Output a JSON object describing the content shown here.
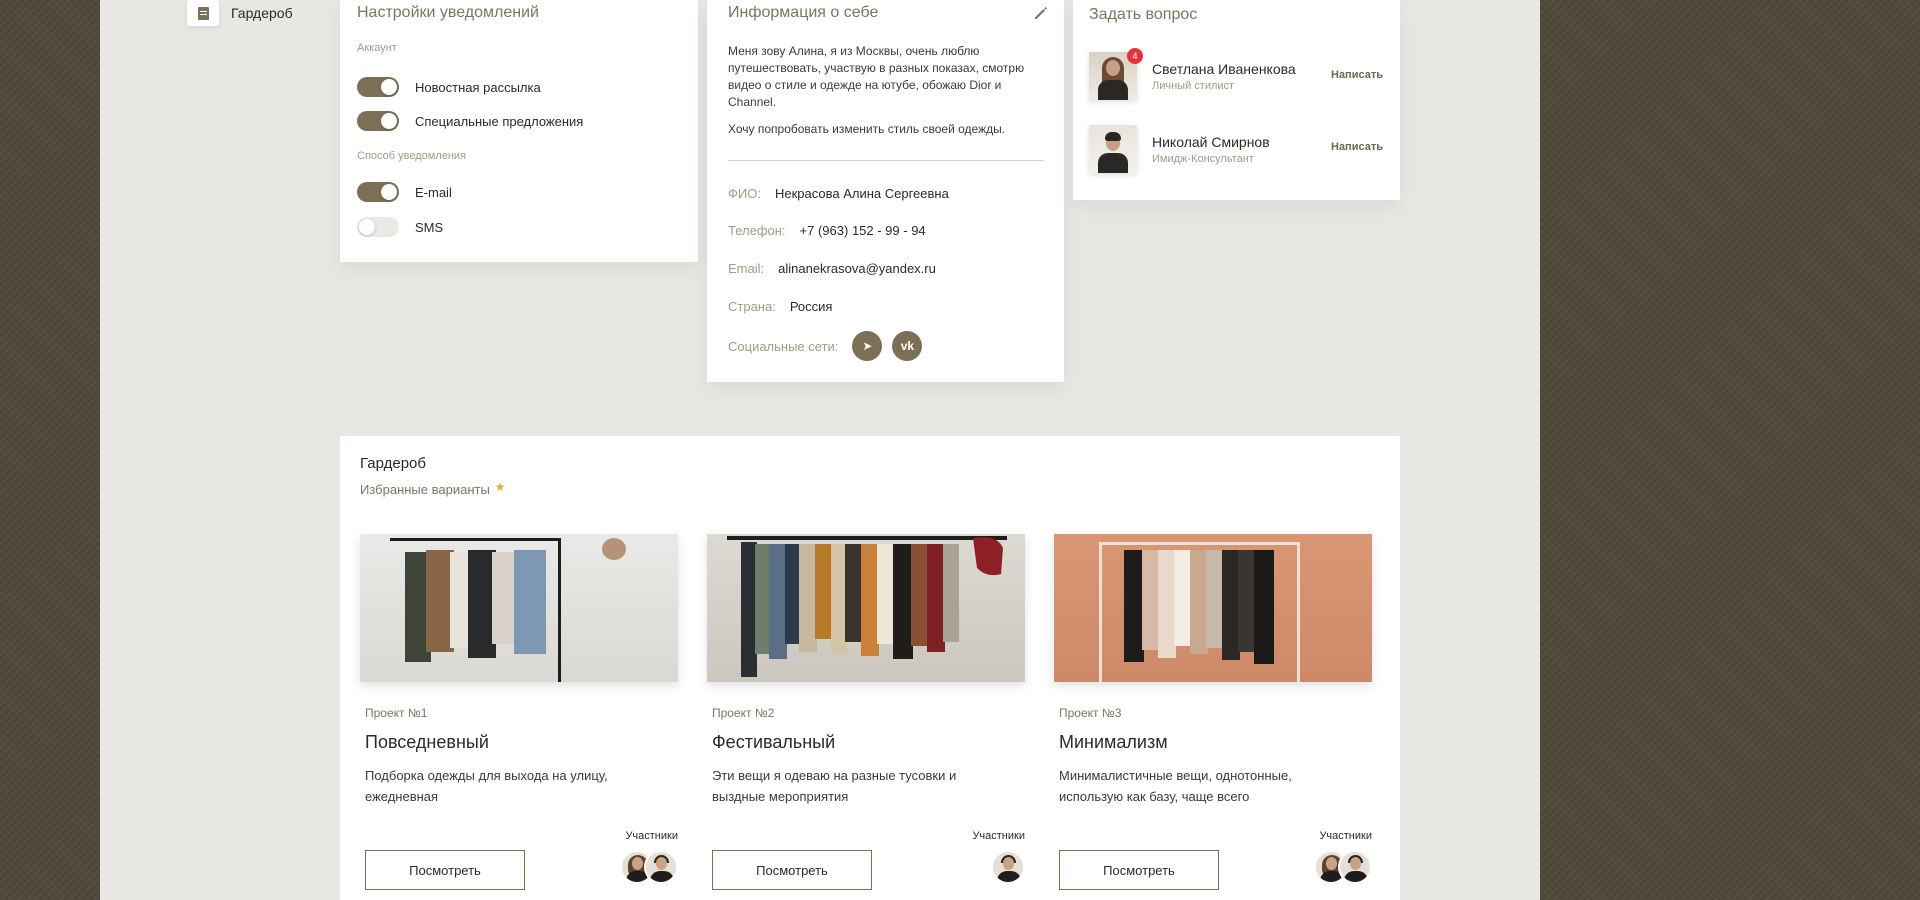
{
  "sidebar": {
    "item_label": "Гардероб"
  },
  "notifications": {
    "title": "Настройки уведомлений",
    "account_label": "Аккаунт",
    "account_toggles": [
      {
        "label": "Новостная рассылка",
        "on": true
      },
      {
        "label": "Специальные предложения",
        "on": true
      }
    ],
    "method_label": "Способ уведомления",
    "method_toggles": [
      {
        "label": "E-mail",
        "on": true
      },
      {
        "label": "SMS",
        "on": false
      }
    ]
  },
  "about": {
    "title": "Информация о себе",
    "edit_icon": "pencil-icon",
    "paragraph1": "Меня зову Алина, я из Москвы, очень люблю путешествовать, участвую в разных показах, смотрю видео о стиле и одежде на ютубе, обожаю Dior и Channel.",
    "paragraph2": "Хочу попробовать изменить стиль своей одежды.",
    "fields": [
      {
        "key": "ФИО:",
        "value": "Некрасова Алина Сергеевна"
      },
      {
        "key": "Телефон:",
        "value": "+7 (963) 152 - 99 - 94"
      },
      {
        "key": "Email:",
        "value": "alinanekrasova@yandex.ru"
      },
      {
        "key": "Страна:",
        "value": "Россия"
      }
    ],
    "social_label": "Социальные сети:",
    "socials": [
      {
        "icon": "telegram-icon",
        "glyph": "➤"
      },
      {
        "icon": "vk-icon",
        "glyph": "vk"
      }
    ]
  },
  "ask": {
    "title": "Задать вопрос",
    "people": [
      {
        "name": "Светлана Иваненкова",
        "role": "Личный стилист",
        "badge": "4",
        "action": "Написать"
      },
      {
        "name": "Николай Смирнов",
        "role": "Имидж-Консультант",
        "badge": "",
        "action": "Написать"
      }
    ]
  },
  "wardrobe": {
    "title": "Гардероб",
    "favorites_label": "Избранные варианты",
    "projects": [
      {
        "number": "Проект №1",
        "title": "Повседневный",
        "description": "Подборка одежды для выхода на улицу, ежедневная",
        "button": "Посмотреть",
        "members_label": "Участники"
      },
      {
        "number": "Проект №2",
        "title": "Фестивальный",
        "description": "Эти вещи я одеваю на разные тусовки и выздные мероприятия",
        "button": "Посмотреть",
        "members_label": "Участники"
      },
      {
        "number": "Проект №3",
        "title": "Минимализм",
        "description": "Минималистичные вещи, однотонные, использую как базу, чаще всего",
        "button": "Посмотреть",
        "members_label": "Участники"
      }
    ]
  },
  "colors": {
    "accent": "#7b7056",
    "badge": "#e2323c",
    "page_bg": "#e9e7e3",
    "outer_bg": "#4f4a3c"
  }
}
